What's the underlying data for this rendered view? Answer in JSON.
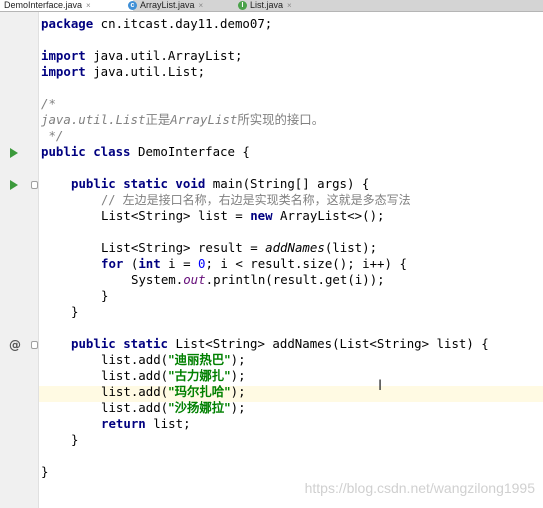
{
  "tabs": [
    {
      "label": "DemoInterface.java",
      "close": "×"
    },
    {
      "label": "ArrayList.java",
      "close": "×",
      "icon_letter": "c"
    },
    {
      "label": "List.java",
      "close": "×",
      "icon_letter": "I"
    }
  ],
  "code": {
    "l1_kw": "package",
    "l1_rest": " cn.itcast.day11.demo07;",
    "l3_kw": "import",
    "l3_rest": " java.util.ArrayList;",
    "l4_kw": "import",
    "l4_rest": " java.util.List;",
    "l6": "/*",
    "l7_a": "java.util.List",
    "l7_b": "正是",
    "l7_c": "ArrayList",
    "l7_d": "所实现的接口。",
    "l8": " */",
    "l9_kw": "public class",
    "l9_rest": " DemoInterface {",
    "l11_kw": "public static void",
    "l11_rest": " main(String[] args) {",
    "l12": "// 左边是接口名称，右边是实现类名称，这就是多态写法",
    "l13_a": "List<String> list = ",
    "l13_kw": "new",
    "l13_b": " ArrayList<>();",
    "l15_a": "List<String> result = ",
    "l15_fn": "addNames",
    "l15_b": "(list);",
    "l16_kw1": "for",
    "l16_a": " (",
    "l16_kw2": "int",
    "l16_b": " i = ",
    "l16_num": "0",
    "l16_c": "; i < result.size(); i++) {",
    "l17_a": "System.",
    "l17_stat": "out",
    "l17_b": ".println(result.get(i));",
    "l18": "}",
    "l19": "}",
    "l21_kw": "public static",
    "l21_rest": " List<String> addNames(List<String> list) {",
    "l22_a": "list.add(",
    "l22_s": "\"迪丽热巴\"",
    "l22_b": ");",
    "l23_a": "list.add(",
    "l23_s": "\"古力娜扎\"",
    "l23_b": ");",
    "l24_a": "list.add(",
    "l24_s": "\"玛尔扎哈\"",
    "l24_b": ");",
    "l25_a": "list.add(",
    "l25_s": "\"沙扬娜拉\"",
    "l25_b": ");",
    "l26_kw": "return",
    "l26_rest": " list;",
    "l27": "}",
    "l29": "}"
  },
  "gutter": {
    "override_marker": "@"
  },
  "watermark": "https://blog.csdn.net/wangzilong1995",
  "text_cursor": "I",
  "colors": {
    "keyword": "#000080",
    "comment": "#808080",
    "string": "#008000",
    "number": "#0000ff",
    "static_field": "#660e7a",
    "run_icon": "#3c9a3c"
  }
}
